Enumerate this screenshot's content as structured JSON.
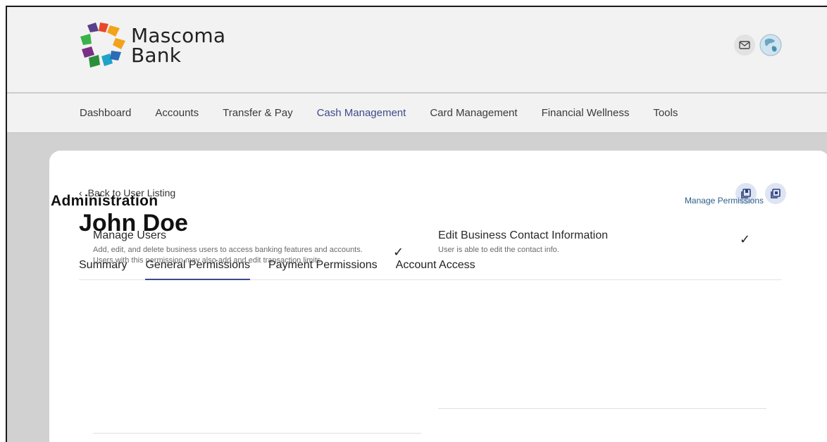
{
  "brand": {
    "name_line1": "Mascoma",
    "name_line2": "Bank",
    "logo_colors": [
      "#5b3f8c",
      "#f2a31b",
      "#38b34a",
      "#1fa3c9",
      "#e8472b",
      "#7a2f86",
      "#2a8f3a",
      "#2c6cb7"
    ]
  },
  "header": {
    "mail_icon": "mail-icon",
    "avatar_icon": "avatar-globe-icon"
  },
  "nav": {
    "items": [
      {
        "label": "Dashboard",
        "active": false
      },
      {
        "label": "Accounts",
        "active": false
      },
      {
        "label": "Transfer & Pay",
        "active": false
      },
      {
        "label": "Cash Management",
        "active": true
      },
      {
        "label": "Card Management",
        "active": false
      },
      {
        "label": "Financial Wellness",
        "active": false
      },
      {
        "label": "Tools",
        "active": false
      }
    ],
    "active_color": "#3d4a8c"
  },
  "page": {
    "back_label": "Back to User Listing",
    "title": "John Doe",
    "action_icons": [
      "export-icon",
      "print-icon"
    ],
    "tabs": [
      {
        "label": "Summary",
        "active": false
      },
      {
        "label": "General Permissions",
        "active": true
      },
      {
        "label": "Payment Permissions",
        "active": false
      },
      {
        "label": "Account Access",
        "active": false
      }
    ]
  },
  "section": {
    "title": "Administration",
    "manage_link": "Manage Permissions",
    "permissions": [
      {
        "name": "Manage Users",
        "description": "Add, edit, and delete business users to access banking features and accounts. Users with this permission may also add and edit transaction limits.",
        "granted": "✓"
      },
      {
        "name": "Edit Business Contact Information",
        "description": "User is able to edit the contact info.",
        "granted": "✓"
      }
    ]
  }
}
